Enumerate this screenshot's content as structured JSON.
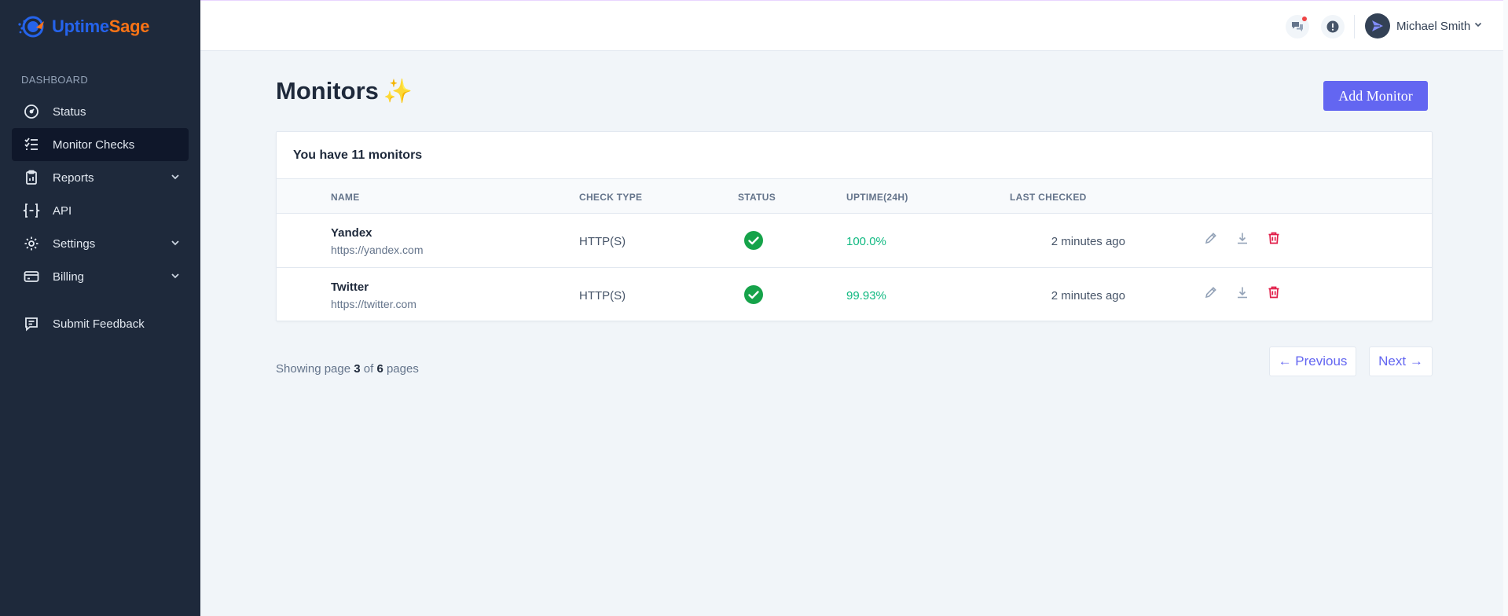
{
  "brand": {
    "part1": "Uptime",
    "part2": "Sage",
    "color1": "#2563eb",
    "color2": "#f97316"
  },
  "sidebar": {
    "section_label": "DASHBOARD",
    "items": [
      {
        "label": "Status",
        "icon": "gauge-icon"
      },
      {
        "label": "Monitor Checks",
        "icon": "checklist-icon",
        "active": true
      },
      {
        "label": "Reports",
        "icon": "clipboard-icon",
        "has_submenu": true
      },
      {
        "label": "API",
        "icon": "code-braces-icon"
      },
      {
        "label": "Settings",
        "icon": "gear-icon",
        "has_submenu": true
      },
      {
        "label": "Billing",
        "icon": "credit-card-icon",
        "has_submenu": true
      },
      {
        "label": "Submit Feedback",
        "icon": "message-icon"
      }
    ]
  },
  "topbar": {
    "user_name": "Michael Smith"
  },
  "main": {
    "title": "Monitors",
    "title_emoji": "✨",
    "add_button": "Add Monitor",
    "card_title": "You have 11 monitors",
    "columns": [
      "NAME",
      "CHECK TYPE",
      "STATUS",
      "UPTIME(24H)",
      "LAST CHECKED"
    ],
    "rows": [
      {
        "name": "Yandex",
        "url": "https://yandex.com",
        "type": "HTTP(S)",
        "status": "up",
        "uptime": "100.0%",
        "last_checked": "2 minutes ago"
      },
      {
        "name": "Twitter",
        "url": "https://twitter.com",
        "type": "HTTP(S)",
        "status": "up",
        "uptime": "99.93%",
        "last_checked": "2 minutes ago"
      }
    ]
  },
  "pagination": {
    "prefix": "Showing page",
    "current": "3",
    "middle": "of",
    "total": "6",
    "suffix": "pages",
    "previous": "← Previous",
    "next": "Next →"
  },
  "colors": {
    "accent": "#6366f1",
    "success": "#10b981",
    "danger": "#e11d48",
    "sidebar_bg": "#1e293b"
  }
}
